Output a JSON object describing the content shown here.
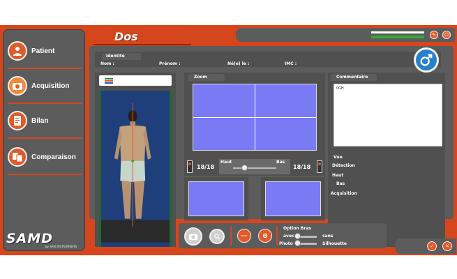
{
  "app": {
    "title": "Dos",
    "logo_text": "SAMD",
    "logo_sub": "by SAM INSTRUMENTS",
    "accent_color": "#d6461c",
    "panel_color": "#5c5c5c",
    "view_color": "#7a7af5"
  },
  "sidebar": {
    "items": [
      {
        "label": "Patient",
        "icon": "patient-icon"
      },
      {
        "label": "Acquisition",
        "icon": "camera-icon"
      },
      {
        "label": "Bilan",
        "icon": "report-icon"
      },
      {
        "label": "Comparaison",
        "icon": "compare-icon"
      }
    ]
  },
  "identity": {
    "tab": "Identité",
    "nom": "Nom :",
    "prenom": "Prénom :",
    "ne_le": "Né(e) le :",
    "imc": "IMC :",
    "gender_icon": "male-icon"
  },
  "zoom": {
    "tab": "Zoom",
    "haut_label": "Haut",
    "bas_label": "Bas",
    "count_left": "18/18",
    "count_right": "18/18",
    "slider_value": 0.25
  },
  "comment": {
    "tab": "Commentaire",
    "text": "0GH",
    "vue": "Vue",
    "detection": "Détection",
    "haut": "Haut",
    "bas": "Bas",
    "acquisition": "Acquisition"
  },
  "options": {
    "title": "Option Bras",
    "avec": "avec",
    "sans": "sans",
    "photo": "Photo",
    "silhouette": "Silhouette",
    "reset_label": "RESET",
    "bras_value": 0,
    "photo_value": 0
  }
}
